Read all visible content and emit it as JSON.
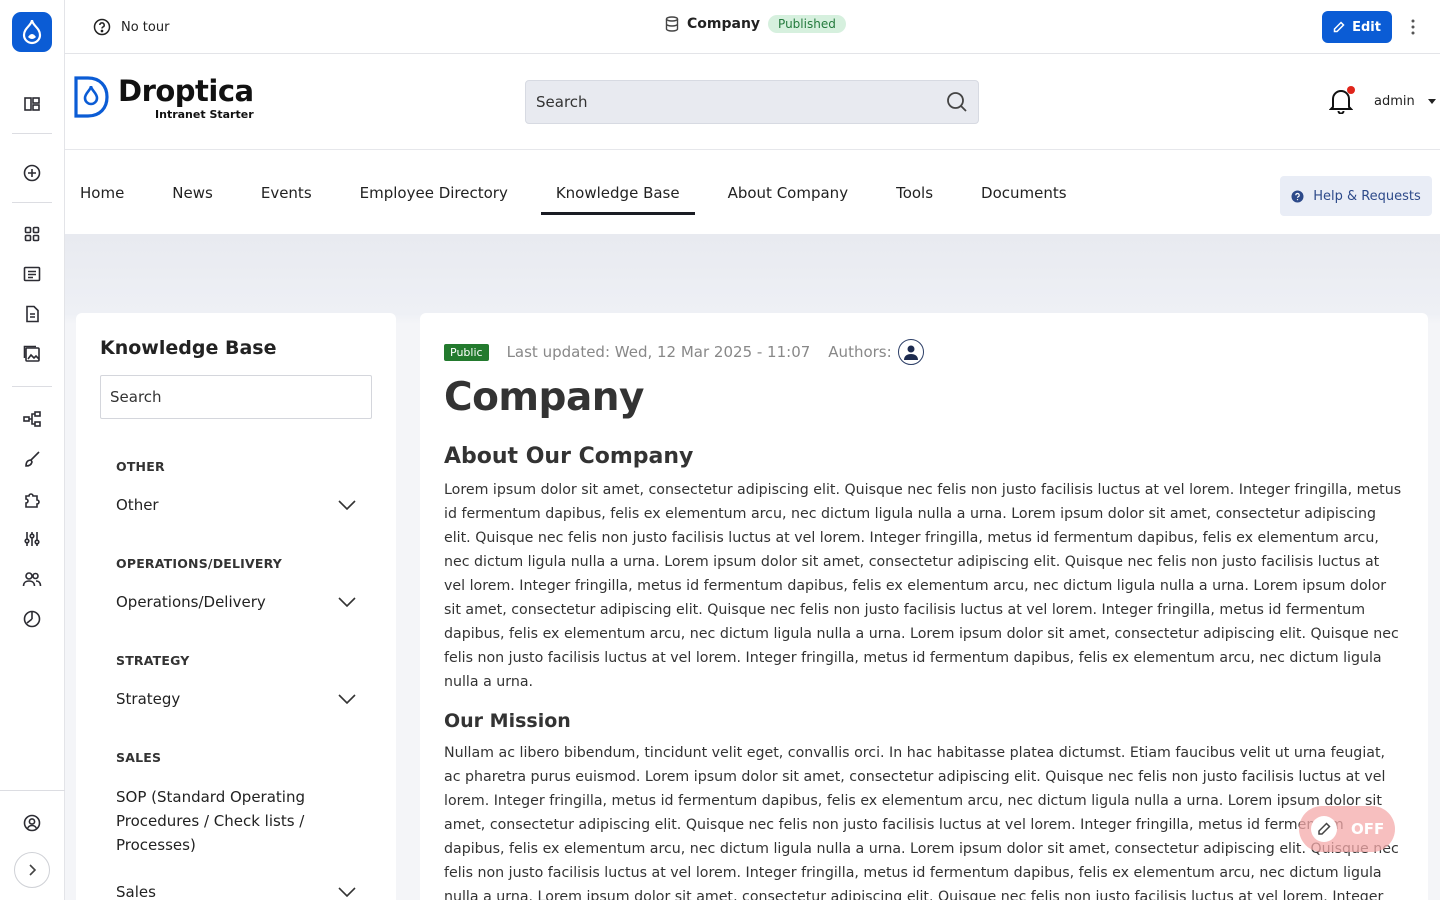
{
  "topbar": {
    "tour_label": "No tour",
    "page_title": "Company",
    "status": "Published",
    "edit_label": "Edit"
  },
  "header": {
    "brand_name": "Droptica",
    "brand_tagline": "Intranet Starter",
    "search_placeholder": "Search",
    "user_name": "admin"
  },
  "nav": {
    "items": [
      "Home",
      "News",
      "Events",
      "Employee Directory",
      "Knowledge Base",
      "About Company",
      "Tools",
      "Documents"
    ],
    "active": "Knowledge Base",
    "help_label": "Help & Requests"
  },
  "sidebar": {
    "title": "Knowledge Base",
    "search_placeholder": "Search",
    "sections": [
      {
        "heading": "OTHER",
        "item": "Other"
      },
      {
        "heading": "OPERATIONS/DELIVERY",
        "item": "Operations/Delivery"
      },
      {
        "heading": "STRATEGY",
        "item": "Strategy"
      },
      {
        "heading": "SALES",
        "link": "SOP (Standard Operating Procedures / Check lists / Processes)",
        "item": "Sales"
      }
    ]
  },
  "article": {
    "badge": "Public",
    "last_updated": "Last updated: Wed, 12 Mar 2025 - 11:07",
    "authors_label": "Authors:",
    "title": "Company",
    "section1_heading": "About Our Company",
    "section1_body": "Lorem ipsum dolor sit amet, consectetur adipiscing elit. Quisque nec felis non justo facilisis luctus at vel lorem. Integer fringilla, metus id fermentum dapibus, felis ex elementum arcu, nec dictum ligula nulla a urna. Lorem ipsum dolor sit amet, consectetur adipiscing elit. Quisque nec felis non justo facilisis luctus at vel lorem. Integer fringilla, metus id fermentum dapibus, felis ex elementum arcu, nec dictum ligula nulla a urna. Lorem ipsum dolor sit amet, consectetur adipiscing elit. Quisque nec felis non justo facilisis luctus at vel lorem. Integer fringilla, metus id fermentum dapibus, felis ex elementum arcu, nec dictum ligula nulla a urna. Lorem ipsum dolor sit amet, consectetur adipiscing elit. Quisque nec felis non justo facilisis luctus at vel lorem. Integer fringilla, metus id fermentum dapibus, felis ex elementum arcu, nec dictum ligula nulla a urna. Lorem ipsum dolor sit amet, consectetur adipiscing elit. Quisque nec felis non justo facilisis luctus at vel lorem. Integer fringilla, metus id fermentum dapibus, felis ex elementum arcu, nec dictum ligula nulla a urna.",
    "section2_heading": "Our Mission",
    "section2_body": "Nullam ac libero bibendum, tincidunt velit eget, convallis orci. In hac habitasse platea dictumst. Etiam faucibus velit ut urna feugiat, ac pharetra purus euismod. Lorem ipsum dolor sit amet, consectetur adipiscing elit. Quisque nec felis non justo facilisis luctus at vel lorem. Integer fringilla, metus id fermentum dapibus, felis ex elementum arcu, nec dictum ligula nulla a urna. Lorem ipsum dolor sit amet, consectetur adipiscing elit. Quisque nec felis non justo facilisis luctus at vel lorem. Integer fringilla, metus id fermentum dapibus, felis ex elementum arcu, nec dictum ligula nulla a urna. Lorem ipsum dolor sit amet, consectetur adipiscing elit. Quisque nec felis non justo facilisis luctus at vel lorem. Integer fringilla, metus id fermentum dapibus, felis ex elementum arcu, nec dictum ligula nulla a urna. Lorem ipsum dolor sit amet, consectetur adipiscing elit. Quisque nec felis non justo facilisis luctus at vel lorem. Integer fringilla, metus id fermentum dapibus, felis ex elementum arcu, nec dictum ligula nulla a urna."
  },
  "toggle": {
    "label": "OFF"
  },
  "colors": {
    "accent": "#0b5cd5",
    "public_badge": "#237a2e",
    "published_badge": "#d6f0de"
  },
  "icons": {
    "rail": [
      "drupal-logo-icon",
      "layout-icon",
      "add-circle-icon",
      "dashboard-icon",
      "content-icon",
      "files-icon",
      "media-icon",
      "structure-icon",
      "appearance-icon",
      "extend-icon",
      "config-icon",
      "people-icon",
      "reports-icon",
      "user-profile-icon",
      "expand-icon"
    ]
  }
}
